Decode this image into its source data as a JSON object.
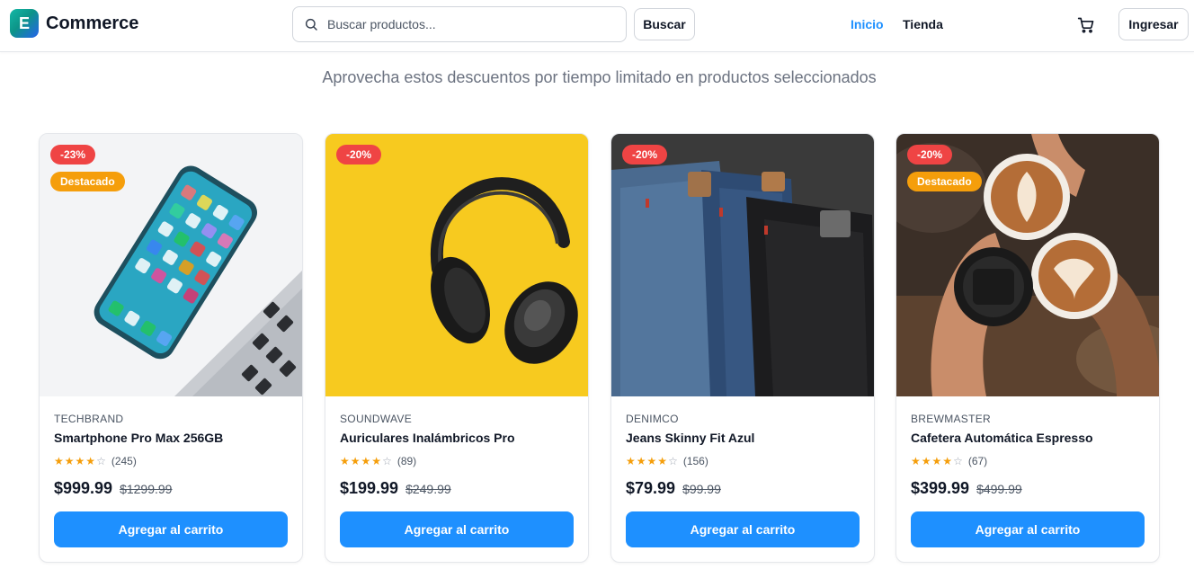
{
  "header": {
    "logo_letter": "E",
    "logo_text": "Commerce",
    "search_placeholder": "Buscar productos...",
    "search_button": "Buscar",
    "nav": [
      {
        "label": "Inicio",
        "active": true
      },
      {
        "label": "Tienda",
        "active": false
      }
    ],
    "cart_icon": "shopping-cart-icon",
    "login_button": "Ingresar"
  },
  "subtitle": "Aprovecha estos descuentos por tiempo limitado en productos seleccionados",
  "products": [
    {
      "brand": "TECHBRAND",
      "name": "Smartphone Pro Max 256GB",
      "discount": "-23%",
      "featured": "Destacado",
      "rating": 4,
      "reviews": "(245)",
      "price": "$999.99",
      "old_price": "$1299.99",
      "button": "Agregar al carrito",
      "image": "smartphone-photo"
    },
    {
      "brand": "SOUNDWAVE",
      "name": "Auriculares Inalámbricos Pro",
      "discount": "-20%",
      "featured": null,
      "rating": 4,
      "reviews": "(89)",
      "price": "$199.99",
      "old_price": "$249.99",
      "button": "Agregar al carrito",
      "image": "headphones-photo"
    },
    {
      "brand": "DENIMCO",
      "name": "Jeans Skinny Fit Azul",
      "discount": "-20%",
      "featured": null,
      "rating": 4,
      "reviews": "(156)",
      "price": "$79.99",
      "old_price": "$99.99",
      "button": "Agregar al carrito",
      "image": "jeans-photo"
    },
    {
      "brand": "BREWMASTER",
      "name": "Cafetera Automática Espresso",
      "discount": "-20%",
      "featured": "Destacado",
      "rating": 4,
      "reviews": "(67)",
      "price": "$399.99",
      "old_price": "$499.99",
      "button": "Agregar al carrito",
      "image": "coffee-photo"
    }
  ],
  "colors": {
    "accent": "#1e90ff",
    "discount_badge": "#ef4444",
    "featured_badge": "#f59e0b",
    "star": "#f59e0b"
  }
}
